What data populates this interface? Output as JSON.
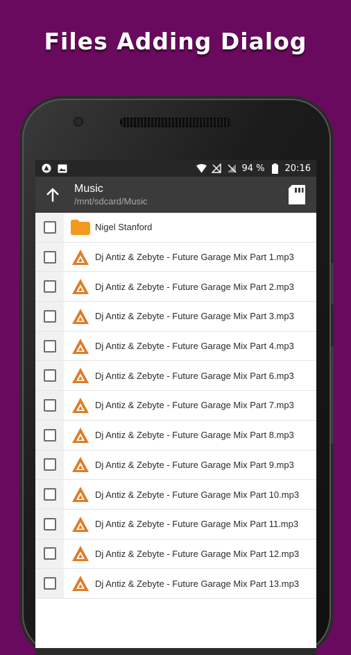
{
  "promo": {
    "title": "Files Adding Dialog"
  },
  "colors": {
    "background": "#6a0a5e",
    "status_bar": "#262626",
    "toolbar": "#3b3b3b",
    "folder": "#f39a1e",
    "music_icon": "#e07b25"
  },
  "status_bar": {
    "left_icons": [
      "notification-a-icon",
      "image-icon"
    ],
    "right_icons": [
      "wifi-icon",
      "no-signal-icon",
      "no-sim-icon",
      "battery-icon"
    ],
    "battery": "94 %",
    "time": "20:16"
  },
  "toolbar": {
    "up_icon": "arrow-up-icon",
    "title": "Music",
    "path": "/mnt/sdcard/Music",
    "storage_icon": "sd-card-icon"
  },
  "files": [
    {
      "name": "Nigel Stanford",
      "type": "folder",
      "checked": false
    },
    {
      "name": "Dj Antiz & Zebyte - Future Garage Mix Part 1.mp3",
      "type": "audio",
      "checked": false
    },
    {
      "name": "Dj Antiz & Zebyte - Future Garage Mix Part 2.mp3",
      "type": "audio",
      "checked": false
    },
    {
      "name": "Dj Antiz & Zebyte - Future Garage Mix Part 3.mp3",
      "type": "audio",
      "checked": false
    },
    {
      "name": "Dj Antiz & Zebyte - Future Garage Mix Part 4.mp3",
      "type": "audio",
      "checked": false
    },
    {
      "name": "Dj Antiz & Zebyte - Future Garage Mix Part 6.mp3",
      "type": "audio",
      "checked": false
    },
    {
      "name": "Dj Antiz & Zebyte - Future Garage Mix Part 7.mp3",
      "type": "audio",
      "checked": false
    },
    {
      "name": "Dj Antiz & Zebyte - Future Garage Mix Part 8.mp3",
      "type": "audio",
      "checked": false
    },
    {
      "name": "Dj Antiz & Zebyte - Future Garage Mix Part 9.mp3",
      "type": "audio",
      "checked": false
    },
    {
      "name": "Dj Antiz & Zebyte - Future Garage Mix Part 10.mp3",
      "type": "audio",
      "checked": false
    },
    {
      "name": "Dj Antiz & Zebyte - Future Garage Mix Part 11.mp3",
      "type": "audio",
      "checked": false
    },
    {
      "name": "Dj Antiz & Zebyte - Future Garage Mix Part 12.mp3",
      "type": "audio",
      "checked": false
    },
    {
      "name": "Dj Antiz & Zebyte - Future Garage Mix Part 13.mp3",
      "type": "audio",
      "checked": false
    }
  ]
}
